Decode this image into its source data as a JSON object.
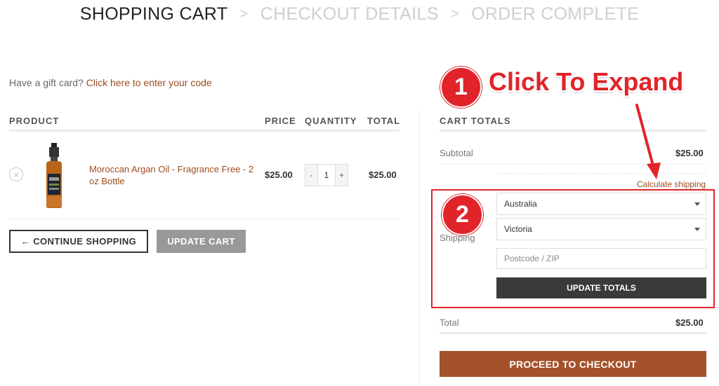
{
  "steps": {
    "active": "SHOPPING CART",
    "step2": "CHECKOUT DETAILS",
    "step3": "ORDER COMPLETE",
    "separator": ">"
  },
  "gift": {
    "prompt": "Have a gift card?",
    "link": "Click here to enter your code"
  },
  "cart": {
    "headers": {
      "product": "PRODUCT",
      "price": "PRICE",
      "quantity": "QUANTITY",
      "total": "TOTAL"
    },
    "items": [
      {
        "name": "Moroccan Argan Oil - Fragrance Free - 2 oz Bottle",
        "price": "$25.00",
        "qty": "1",
        "total": "$25.00",
        "remove_icon": "×",
        "minus": "-",
        "plus": "+"
      }
    ],
    "continue_label": "← CONTINUE SHOPPING",
    "update_label": "UPDATE CART"
  },
  "totals": {
    "heading": "CART TOTALS",
    "subtotal_label": "Subtotal",
    "subtotal_value": "$25.00",
    "calculate_link": "Calculate shipping",
    "shipping_label": "Shipping",
    "country": "Australia",
    "state": "Victoria",
    "postcode_placeholder": "Postcode / ZIP",
    "update_totals_label": "UPDATE TOTALS",
    "total_label": "Total",
    "total_value": "$25.00",
    "checkout_label": "PROCEED TO CHECKOUT"
  },
  "annotation": {
    "badge1": "1",
    "badge2": "2",
    "title": "Click To Expand",
    "color": "#e1242a"
  },
  "colors": {
    "link": "#9b4d1f",
    "checkout_button": "#a4522a",
    "update_totals_button": "#3a3a3a",
    "update_cart_button": "#999999"
  },
  "icons": [
    "remove-item-icon",
    "dropdown-caret-icon",
    "arrow-icon",
    "product-bottle-image"
  ]
}
